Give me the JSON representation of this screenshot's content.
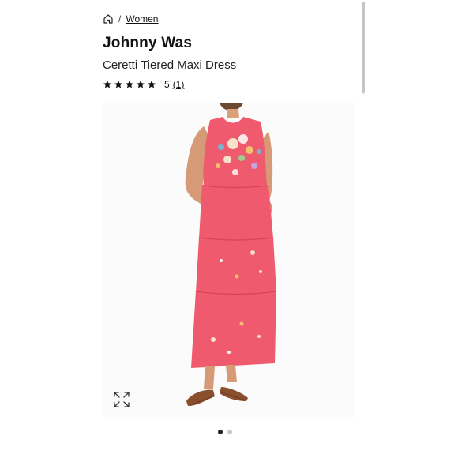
{
  "breadcrumb": {
    "home_icon": "home-icon",
    "separator": "/",
    "current": "Women"
  },
  "product": {
    "brand": "Johnny Was",
    "name": "Ceretti Tiered Maxi Dress",
    "rating": {
      "stars": 5,
      "stars_total": 5,
      "value": "5",
      "count": "(1)"
    },
    "dress_color": "#f05a6e"
  },
  "gallery": {
    "expand_icon": "expand-icon",
    "slides_total": 2,
    "active_slide": 1
  }
}
